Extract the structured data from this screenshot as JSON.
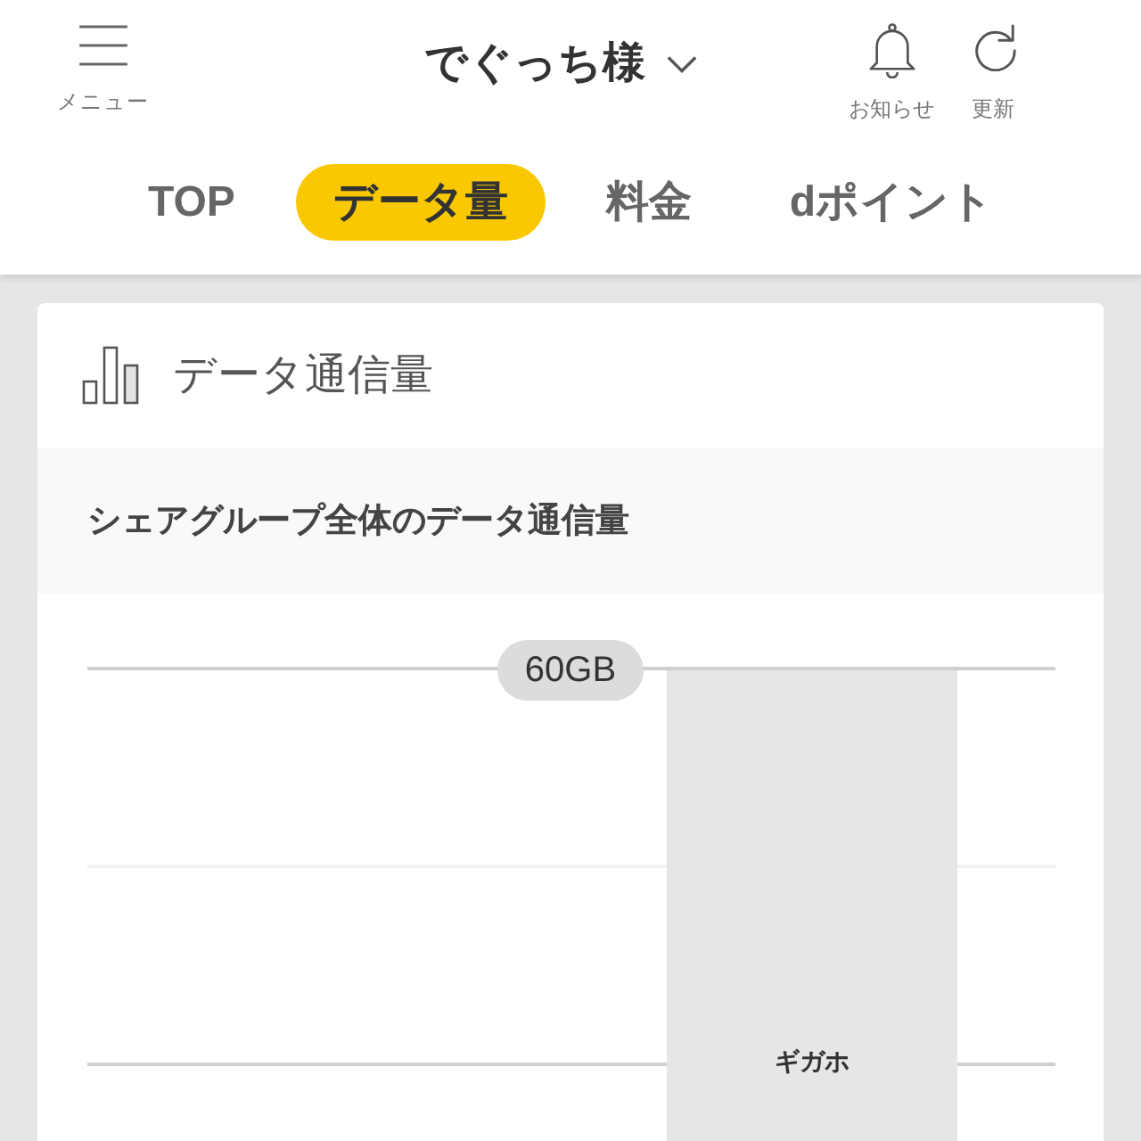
{
  "header": {
    "menu": {
      "label": "メニュー"
    },
    "account": {
      "name": "でぐっち様"
    },
    "actions": [
      {
        "kind": "bell",
        "label": "お知らせ"
      },
      {
        "kind": "refresh",
        "label": "更新"
      }
    ]
  },
  "tabs": [
    {
      "label": "TOP",
      "selected": false
    },
    {
      "label": "データ量",
      "selected": true
    },
    {
      "label": "料金",
      "selected": false
    },
    {
      "label": "dポイント",
      "selected": false
    }
  ],
  "card": {
    "title": "データ通信量",
    "section_title": "シェアグループ全体のデータ通信量",
    "chart": {
      "limit_label": "60GB",
      "bars": [
        {
          "label": "ギガホ"
        }
      ]
    }
  }
}
